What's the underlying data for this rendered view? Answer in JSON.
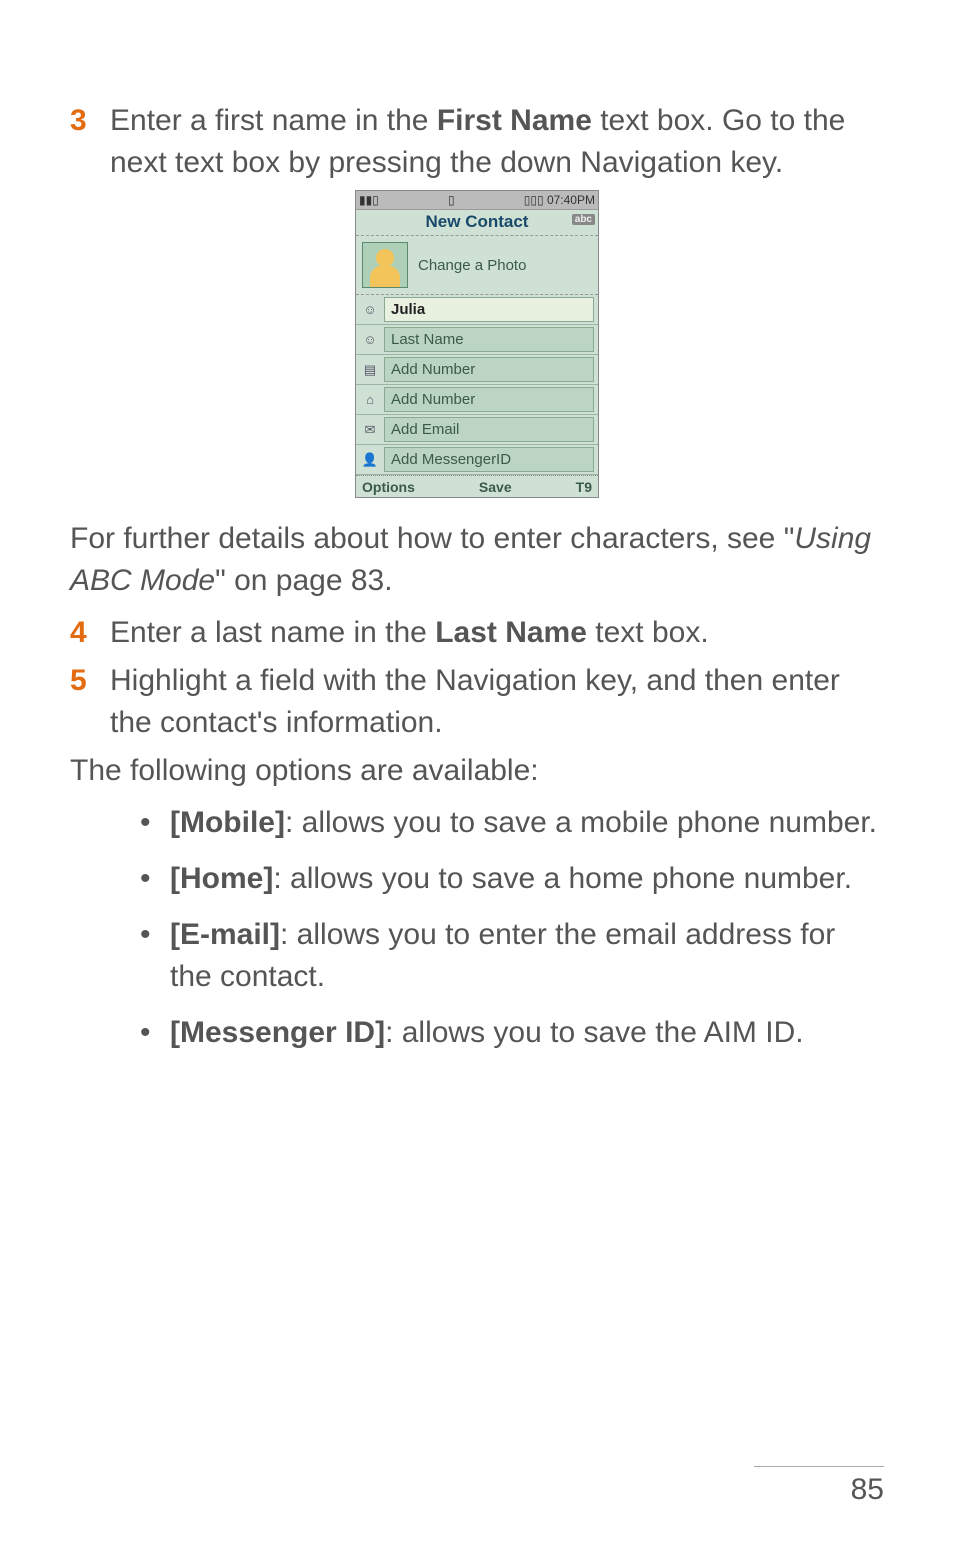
{
  "step3": {
    "num": "3",
    "part1": "Enter a first name in the ",
    "bold": "First Name",
    "part2": " text box. Go to the next text box by pressing the down Navigation key."
  },
  "phone": {
    "status_left": "▮▮▯",
    "status_mid": "▯",
    "status_right": "▯▯▯ 07:40PM",
    "title": "New Contact",
    "abc": "abc",
    "change_photo": "Change a Photo",
    "first_name_value": "Julia",
    "last_name_ph": "Last Name",
    "mobile_ph": "Add Number",
    "home_ph": "Add Number",
    "email_ph": "Add Email",
    "msg_ph": "Add MessengerID",
    "soft_left": "Options",
    "soft_mid": "Save",
    "soft_right": "T9"
  },
  "detail_para": {
    "p1": "For further details about how to enter characters, see \"",
    "italic": "Using ABC Mode",
    "p2": "\" on page 83."
  },
  "step4": {
    "num": "4",
    "part1": "Enter a last name in the ",
    "bold": "Last Name",
    "part2": " text box."
  },
  "step5": {
    "num": "5",
    "text": "Highlight a field with the Navigation key, and then enter the contact's information."
  },
  "options_intro": "The following options are available:",
  "bullets": {
    "mobile": {
      "label": "[Mobile]",
      "text": ": allows you to save a mobile phone number."
    },
    "home": {
      "label": "[Home]",
      "text": ": allows you to save a home phone number."
    },
    "email": {
      "label": "[E-mail]",
      "text": ": allows you to enter the email address for the contact."
    },
    "msg": {
      "label": "[Messenger ID]",
      "text": ": allows you to save the AIM ID."
    }
  },
  "page_number": "85"
}
